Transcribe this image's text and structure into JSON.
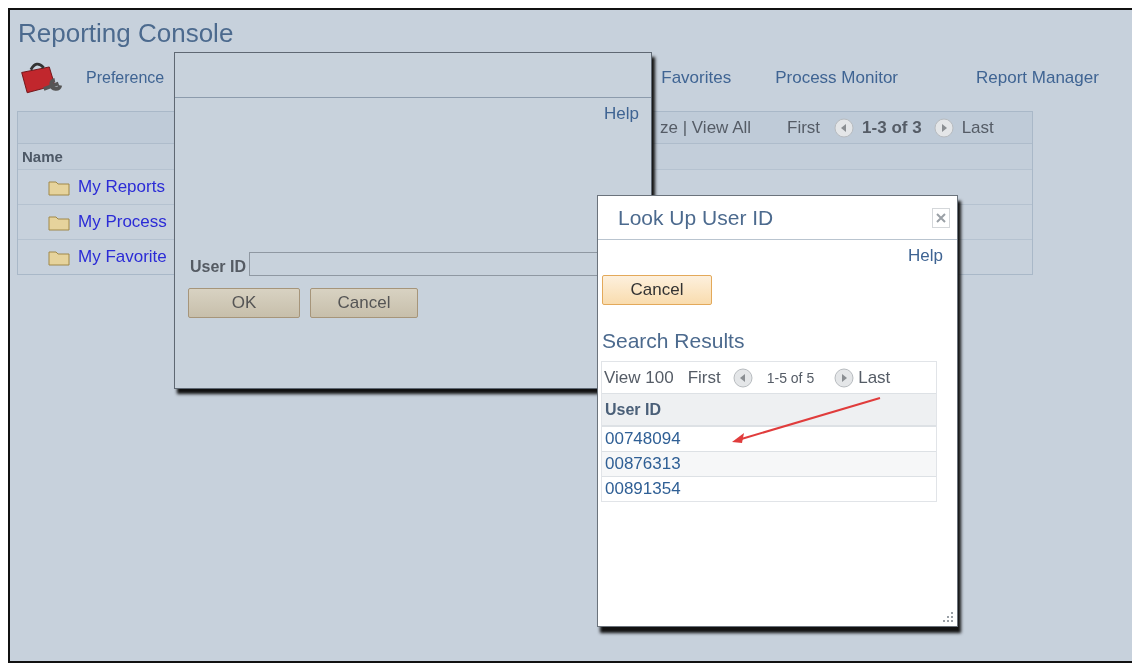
{
  "page": {
    "title": "Reporting Console",
    "nav": [
      {
        "label": "Preference"
      },
      {
        "label": "Favorites"
      },
      {
        "label": "Process Monitor"
      },
      {
        "label": "Report Manager"
      }
    ]
  },
  "grid": {
    "toolbar": {
      "links": "ze | View All",
      "first": "First",
      "range": "1-3 of 3",
      "last": "Last"
    },
    "column": "Name",
    "rows": [
      "My Reports",
      "My Process",
      "My Favorite"
    ]
  },
  "prompt_dialog": {
    "help": "Help",
    "field_label": "User ID",
    "buttons": [
      "OK",
      "Cancel"
    ]
  },
  "lookup_dialog": {
    "title": "Look Up User ID",
    "help": "Help",
    "cancel": "Cancel",
    "section": "Search Results",
    "toolbar": {
      "view": "View 100",
      "first": "First",
      "range": "1-5 of 5",
      "last": "Last"
    },
    "column": "User ID",
    "rows": [
      "00748094",
      "00876313",
      "00891354"
    ]
  }
}
